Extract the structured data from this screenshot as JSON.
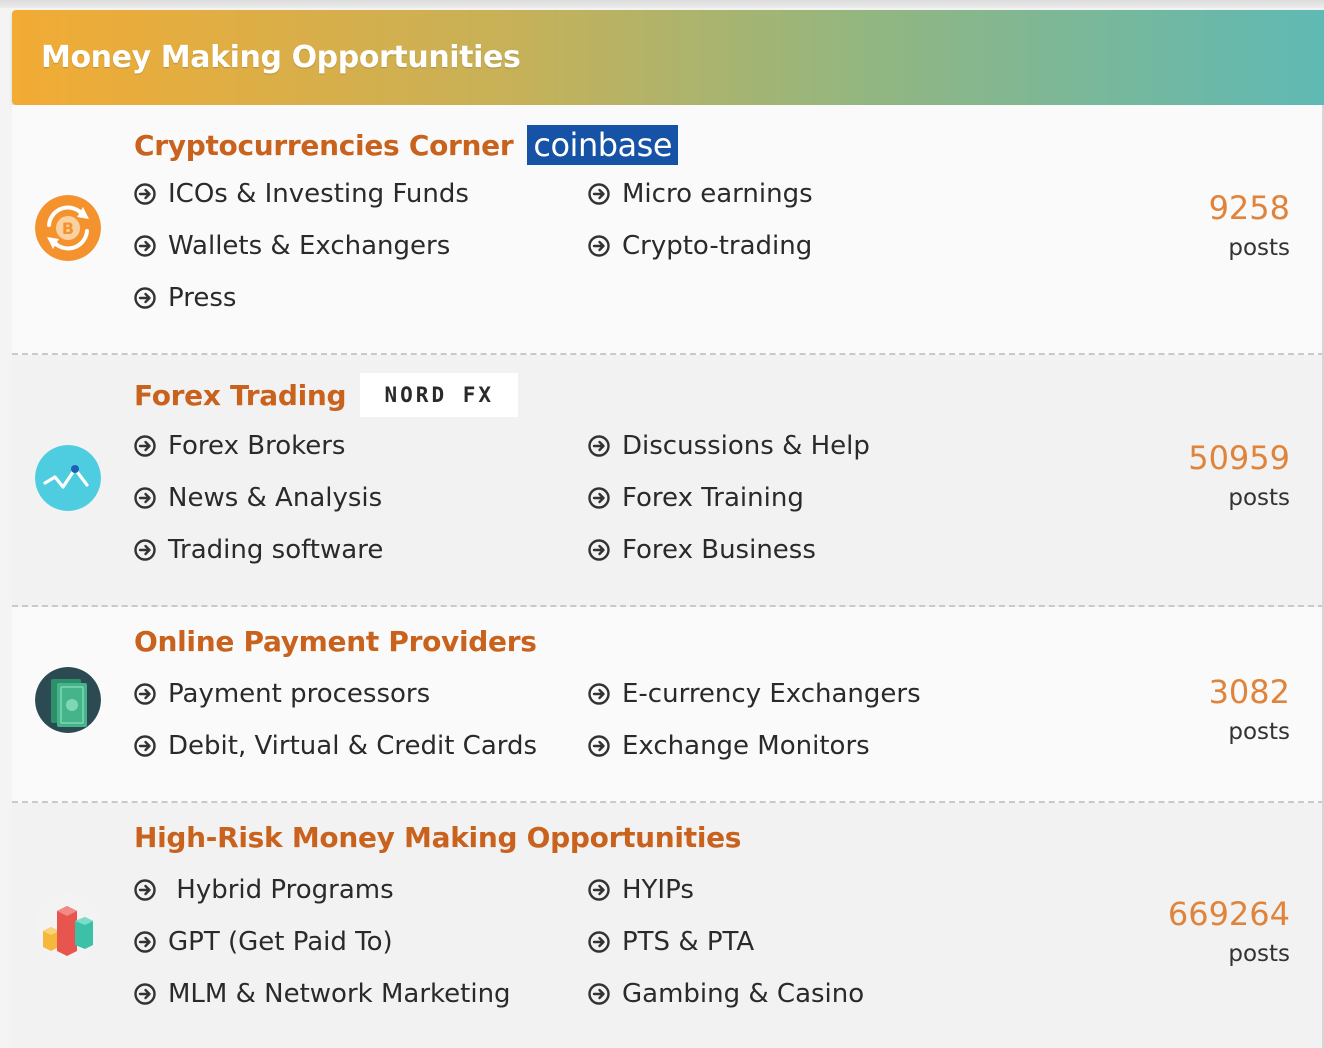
{
  "header": {
    "title": "Money Making Opportunities"
  },
  "forums": [
    {
      "title": "Cryptocurrencies Corner",
      "sponsor": "coinbase",
      "icon": "bitcoin-exchange-icon",
      "subforums": [
        "ICOs & Investing Funds",
        "Micro earnings",
        "Wallets & Exchangers",
        "Crypto-trading",
        "Press"
      ],
      "count": "9258",
      "count_label": "posts"
    },
    {
      "title": "Forex Trading",
      "sponsor": "NORD FX",
      "icon": "forex-chart-icon",
      "subforums": [
        "Forex Brokers",
        "Discussions & Help",
        "News & Analysis",
        "Forex Training",
        "Trading software",
        "Forex Business"
      ],
      "count": "50959",
      "count_label": "posts"
    },
    {
      "title": "Online Payment Providers",
      "icon": "cash-icon",
      "subforums": [
        "Payment processors",
        "E-currency Exchangers",
        "Debit, Virtual & Credit Cards",
        "Exchange Monitors"
      ],
      "count": "3082",
      "count_label": "posts"
    },
    {
      "title": "High-Risk Money Making Opportunities",
      "icon": "bar-blocks-icon",
      "subforums": [
        " Hybrid Programs",
        "HYIPs",
        "GPT (Get Paid To)",
        "PTS & PTA",
        "MLM & Network Marketing",
        "Gambing & Casino"
      ],
      "count": "669264",
      "count_label": "posts"
    }
  ],
  "colors": {
    "title": "#c8621d",
    "count": "#e0843b",
    "header_start": "#f2ab34",
    "header_end": "#5fb9b4"
  }
}
